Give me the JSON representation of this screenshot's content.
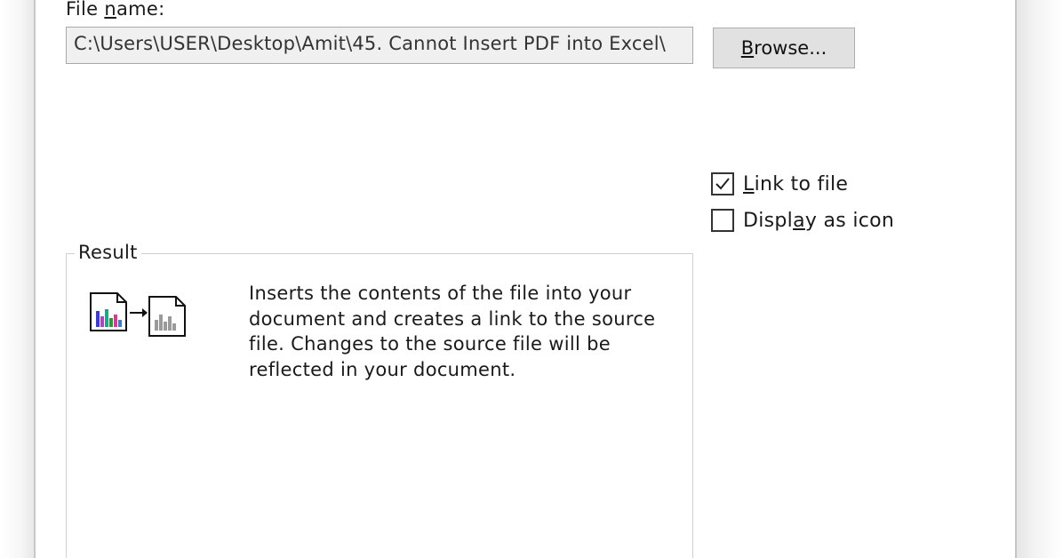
{
  "dialog": {
    "file_name_label_prefix": "File ",
    "file_name_label_accel": "n",
    "file_name_label_suffix": "ame:",
    "file_name_value": "C:\\Users\\USER\\Desktop\\Amit\\45. Cannot Insert PDF into Excel\\",
    "browse_accel": "B",
    "browse_rest": "rowse..."
  },
  "options": {
    "link_to_file": {
      "accel": "L",
      "rest": "ink to file",
      "checked": true
    },
    "display_as_icon": {
      "prefix": "Displ",
      "accel": "a",
      "rest": "y as icon",
      "checked": false
    }
  },
  "result": {
    "title": "Result",
    "description": "Inserts the contents of the file into your document and creates a link to the source file. Changes to the source file will be reflected in your document.",
    "icon": "linked-file-icon"
  },
  "colors": {
    "button_bg": "#e1e1e1",
    "textbox_bg": "#f0f0f0",
    "border": "#a8a8a8"
  }
}
